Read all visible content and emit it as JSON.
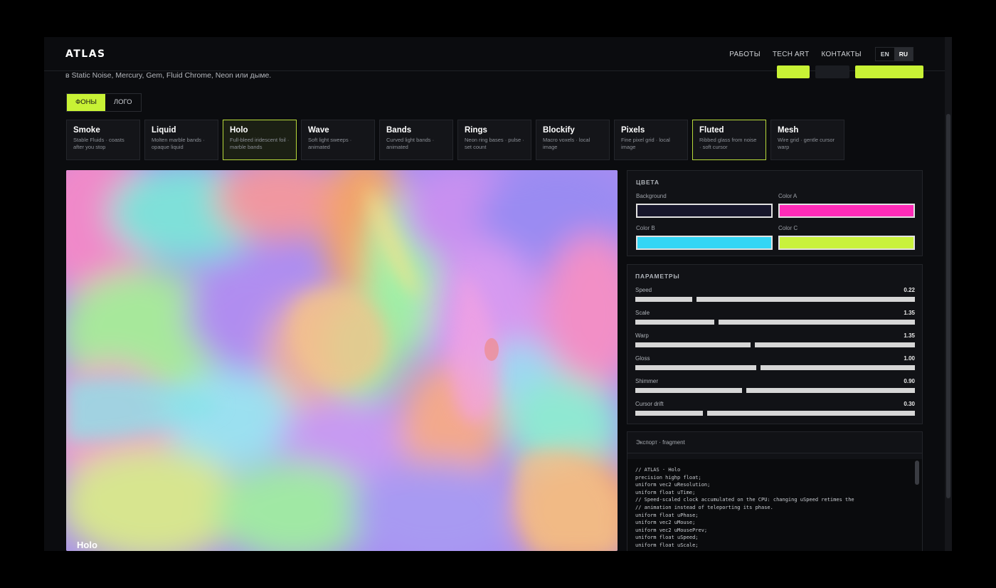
{
  "header": {
    "logo": "ATLAS",
    "nav": [
      "РАБОТЫ",
      "TECH ART",
      "КОНТАКТЫ"
    ],
    "lang": [
      "EN",
      "RU"
    ]
  },
  "subtitle": "в Static Noise, Mercury, Gem, Fluid Chrome, Neon или дыме.",
  "tabs": [
    "ФОНЫ",
    "ЛОГО"
  ],
  "presets": [
    {
      "name": "Smoke",
      "desc": "Stable Fluids · coasts after you stop"
    },
    {
      "name": "Liquid",
      "desc": "Molten marble bands · opaque liquid"
    },
    {
      "name": "Holo",
      "desc": "Full-bleed iridescent foil · marble bands"
    },
    {
      "name": "Wave",
      "desc": "Soft light sweeps · animated"
    },
    {
      "name": "Bands",
      "desc": "Curved light bands · animated"
    },
    {
      "name": "Rings",
      "desc": "Neon ring bases · pulse · set count"
    },
    {
      "name": "Blockify",
      "desc": "Macro voxels · local image"
    },
    {
      "name": "Pixels",
      "desc": "Fine pixel grid · local image"
    },
    {
      "name": "Fluted",
      "desc": "Ribbed glass from noise · soft cursor"
    },
    {
      "name": "Mesh",
      "desc": "Wire grid · gentle cursor warp"
    }
  ],
  "preview": {
    "label": "Holo"
  },
  "colors": {
    "title": "ЦВЕТА",
    "items": [
      {
        "label": "Background",
        "color": "#17162b"
      },
      {
        "label": "Color A",
        "color": "#ff2bb8"
      },
      {
        "label": "Color B",
        "color": "#34d6f5"
      },
      {
        "label": "Color C",
        "color": "#c9f23c"
      }
    ]
  },
  "params": {
    "title": "ПАРАМЕТРЫ",
    "items": [
      {
        "label": "Speed",
        "value": "0.22",
        "level": 0.21
      },
      {
        "label": "Scale",
        "value": "1.35",
        "level": 0.29
      },
      {
        "label": "Warp",
        "value": "1.35",
        "level": 0.42
      },
      {
        "label": "Gloss",
        "value": "1.00",
        "level": 0.44
      },
      {
        "label": "Shimmer",
        "value": "0.90",
        "level": 0.39
      },
      {
        "label": "Cursor drift",
        "value": "0.30",
        "level": 0.25
      }
    ]
  },
  "export": {
    "title": "Экспорт · fragment",
    "code": "// ATLAS · Holo\nprecision highp float;\nuniform vec2 uResolution;\nuniform float uTime;\n// Speed-scaled clock accumulated on the CPU: changing uSpeed retimes the\n// animation instead of teleporting its phase.\nuniform float uPhase;\nuniform vec2 uMouse;\nuniform vec2 uMousePrev;\nuniform float uSpeed;\nuniform float uScale;"
  },
  "accent": "#c8f235"
}
